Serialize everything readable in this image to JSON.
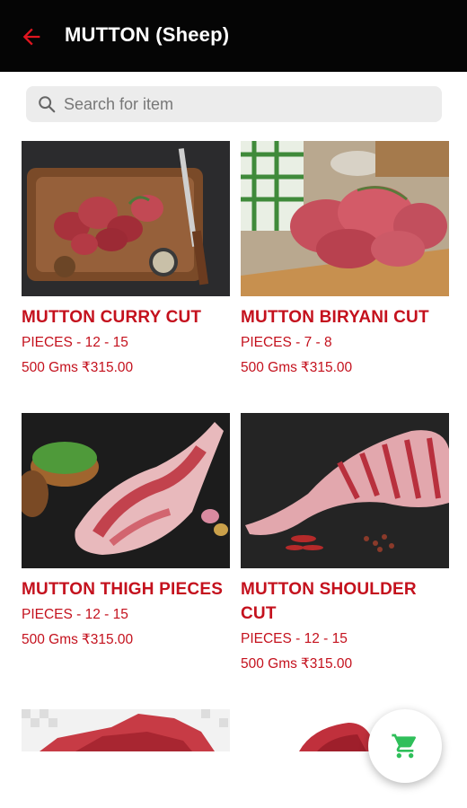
{
  "header": {
    "title": "MUTTON (Sheep)",
    "back_icon": "arrow-left-icon",
    "accent_color": "#d7141f",
    "background": "#050505"
  },
  "search": {
    "placeholder": "Search for item",
    "value": "",
    "icon": "search-icon"
  },
  "products": [
    {
      "name": "MUTTON CURRY CUT",
      "pieces": "PIECES - 12 - 15",
      "weight": "500 Gms",
      "price": "₹315.00"
    },
    {
      "name": "MUTTON BIRYANI CUT",
      "pieces": "PIECES - 7 - 8",
      "weight": "500 Gms",
      "price": "₹315.00"
    },
    {
      "name": "MUTTON THIGH PIECES",
      "pieces": "PIECES - 12 - 15",
      "weight": "500 Gms",
      "price": "₹315.00"
    },
    {
      "name": "MUTTON SHOULDER CUT",
      "pieces": "PIECES - 12 - 15",
      "weight": "500 Gms",
      "price": "₹315.00"
    }
  ],
  "cart": {
    "icon": "shopping-cart-icon",
    "icon_color": "#2fbf5a"
  }
}
